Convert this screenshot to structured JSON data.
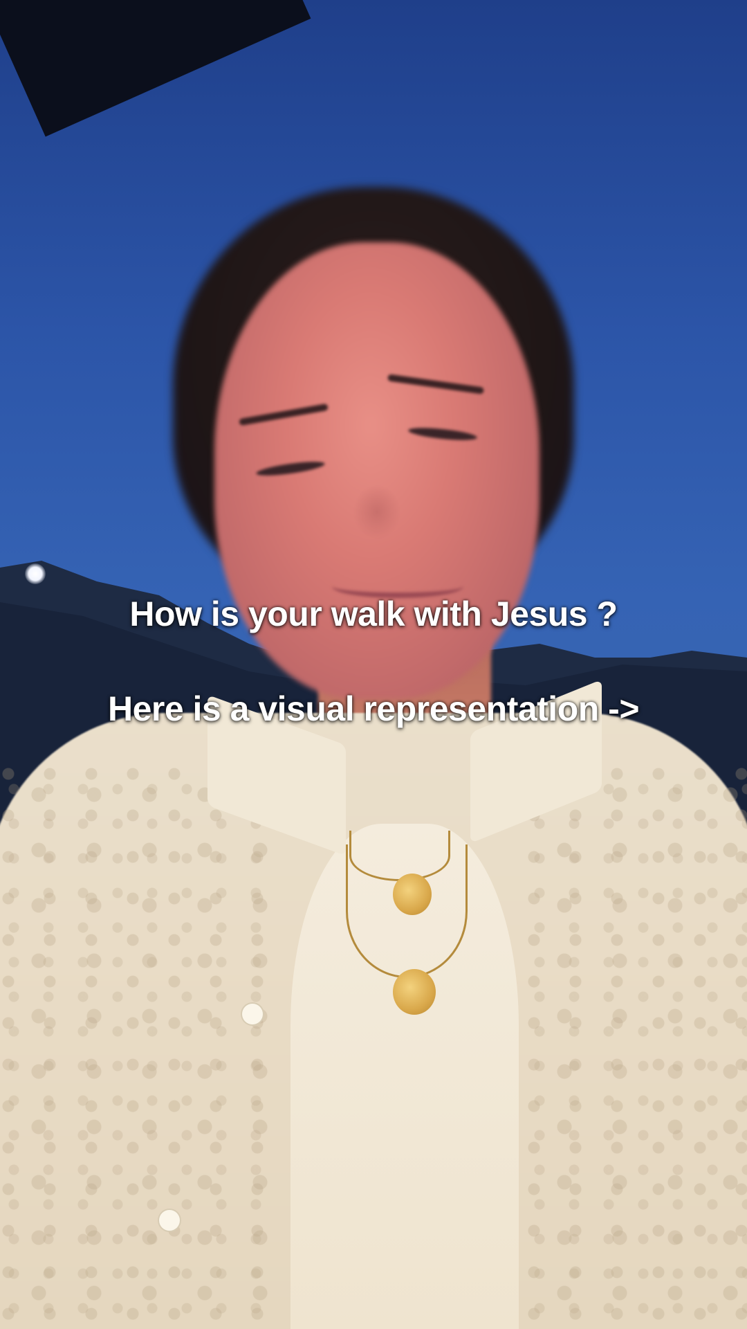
{
  "overlay": {
    "caption_line_1": "How is your walk with Jesus ?",
    "caption_line_2": "Here is a visual representation ->"
  },
  "colors": {
    "sky": "#3563b4",
    "caption_text": "#ffffff",
    "shirt": "#e9dcc6"
  }
}
